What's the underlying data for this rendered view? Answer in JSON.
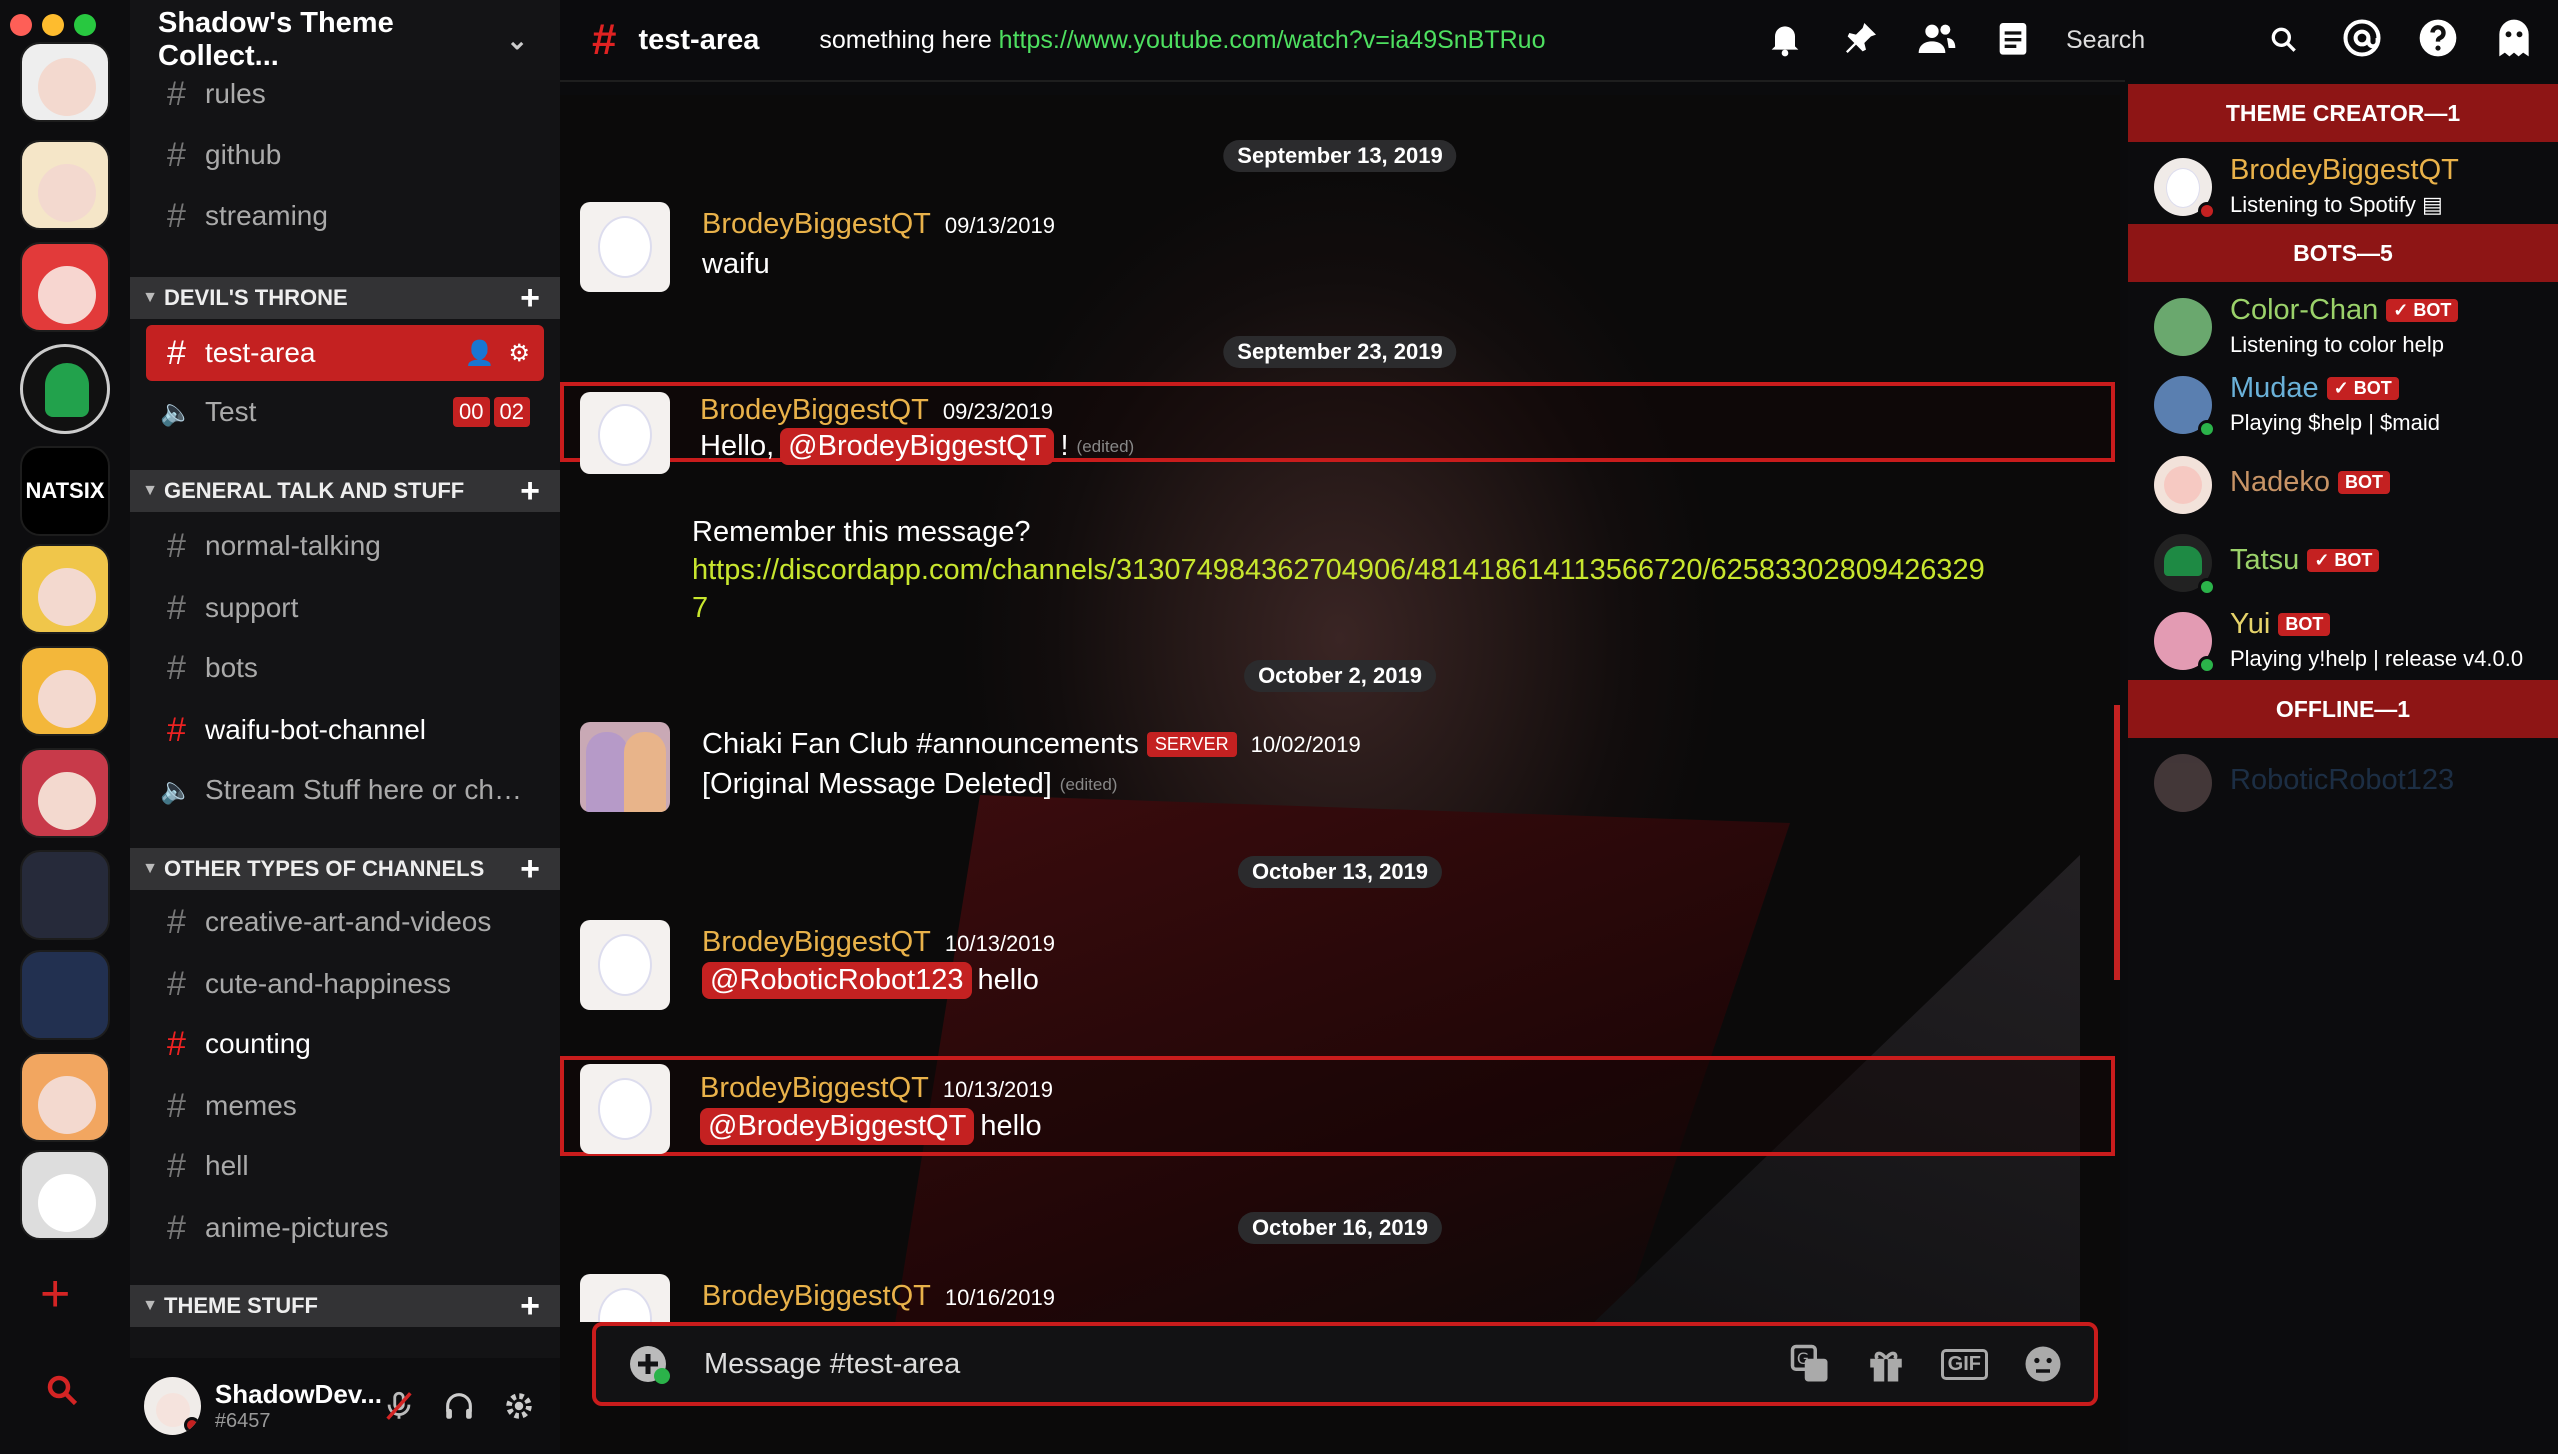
{
  "window": {
    "controls": [
      "close",
      "minimize",
      "maximize"
    ]
  },
  "server": {
    "name": "Shadow's Theme Collect..."
  },
  "guild_icons": [
    "guild-avatar-1",
    "guild-avatar-2",
    "guild-avatar-3",
    "guild-avatar-4",
    "guild-avatar-5",
    "guild-avatar-6",
    "guild-avatar-7",
    "guild-avatar-8",
    "guild-avatar-9",
    "guild-avatar-10",
    "guild-avatar-11",
    "guild-avatar-12"
  ],
  "guild_natsix": "NATSIX",
  "channels": {
    "top": [
      {
        "name": "rules"
      },
      {
        "name": "github"
      },
      {
        "name": "streaming"
      }
    ],
    "cat1": {
      "name": "DEVIL'S THRONE"
    },
    "test_area": {
      "name": "test-area"
    },
    "test": {
      "name": "Test",
      "count1": "00",
      "count2": "02"
    },
    "cat2": {
      "name": "GENERAL TALK AND STUFF"
    },
    "general": [
      {
        "name": "normal-talking"
      },
      {
        "name": "support"
      },
      {
        "name": "bots"
      },
      {
        "name": "waifu-bot-channel"
      },
      {
        "name": "Stream Stuff here or chat ..."
      }
    ],
    "cat3": {
      "name": "OTHER TYPES OF CHANNELS"
    },
    "other": [
      {
        "name": "creative-art-and-videos"
      },
      {
        "name": "cute-and-happiness"
      },
      {
        "name": "counting"
      },
      {
        "name": "memes"
      },
      {
        "name": "hell"
      },
      {
        "name": "anime-pictures"
      }
    ],
    "cat4": {
      "name": "THEME STUFF"
    }
  },
  "user": {
    "name": "ShadowDev...",
    "discriminator": "#6457"
  },
  "topbar": {
    "channel": "test-area",
    "topic_text": "something here ",
    "topic_link": "https://www.youtube.com/watch?v=ia49SnBTRuo",
    "search": "Search"
  },
  "messages": {
    "d1": "September 13, 2019",
    "m1": {
      "author": "BrodeyBiggestQT",
      "time": "09/13/2019",
      "text": "waifu"
    },
    "d2": "September 23, 2019",
    "m2": {
      "author": "BrodeyBiggestQT",
      "time": "09/23/2019",
      "prefix": "Hello,",
      "mention": "@BrodeyBiggestQT",
      "suffix": "!",
      "edited": "(edited)"
    },
    "m2b": {
      "text": "Remember this message?",
      "link1": "https://discordapp.com/channels/313074984362704906/481418614113566720/62583302809426329",
      "link2": "7"
    },
    "d3": "October 2, 2019",
    "m3": {
      "author": "Chiaki Fan Club #announcements",
      "badge": "SERVER",
      "time": "10/02/2019",
      "text": "[Original Message Deleted]",
      "edited": "(edited)"
    },
    "d4": "October 13, 2019",
    "m4": {
      "author": "BrodeyBiggestQT",
      "time": "10/13/2019",
      "mention": "@RoboticRobot123",
      "text": "hello"
    },
    "m5": {
      "author": "BrodeyBiggestQT",
      "time": "10/13/2019",
      "mention": "@BrodeyBiggestQT",
      "text": "hello"
    },
    "d5": "October 16, 2019",
    "m6": {
      "author": "BrodeyBiggestQT",
      "time": "10/16/2019"
    }
  },
  "input": {
    "placeholder": "Message #test-area",
    "gif": "GIF"
  },
  "members": {
    "h1": "THEME CREATOR—1",
    "creator": {
      "name": "BrodeyBiggestQT",
      "status": "Listening to Spotify"
    },
    "h2": "BOTS—5",
    "bots": [
      {
        "name": "Color-Chan",
        "badge": "✓ BOT",
        "status": "Listening to color help"
      },
      {
        "name": "Mudae",
        "badge": "✓ BOT",
        "status": "Playing $help | $maid"
      },
      {
        "name": "Nadeko",
        "badge": "BOT",
        "status": ""
      },
      {
        "name": "Tatsu",
        "badge": "✓ BOT",
        "status": ""
      },
      {
        "name": "Yui",
        "badge": "BOT",
        "status": "Playing y!help | release v4.0.0"
      }
    ],
    "h3": "OFFLINE—1",
    "offline": {
      "name": "RoboticRobot123"
    }
  },
  "colors": {
    "accent": "#c42121",
    "username": "#e9b24a",
    "link": "#c8e62e",
    "topic_link": "#4ee060"
  }
}
